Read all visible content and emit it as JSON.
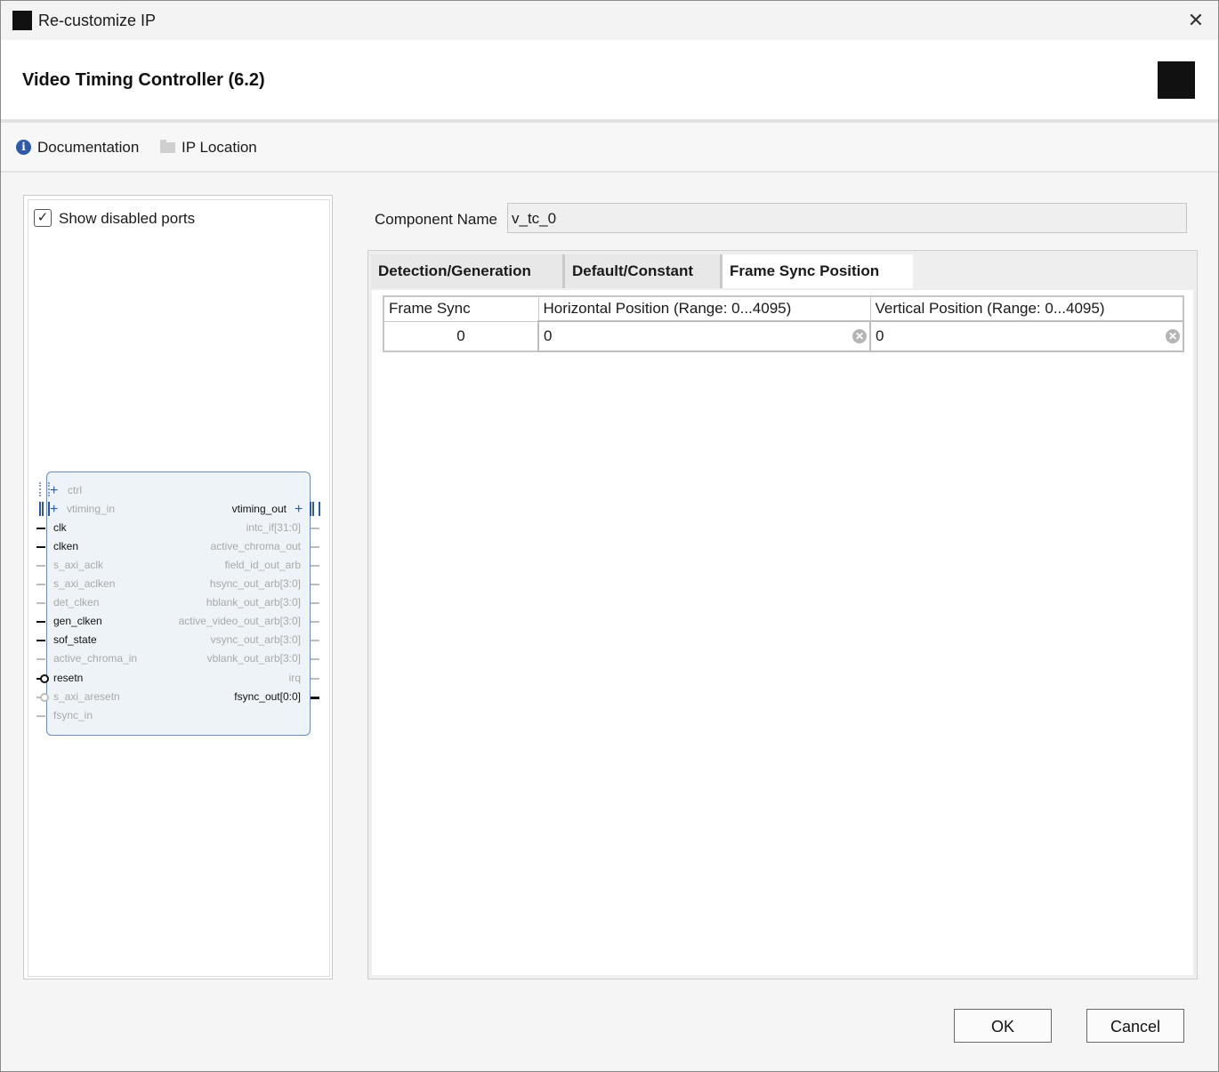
{
  "window": {
    "title": "Re-customize IP",
    "close_glyph": "✕"
  },
  "header": {
    "ip_title": "Video Timing Controller (6.2)"
  },
  "links": {
    "documentation": "Documentation",
    "ip_location": "IP Location"
  },
  "left_panel": {
    "show_disabled_ports_label": "Show disabled ports",
    "show_disabled_ports_checked": true,
    "block_ports_left": [
      {
        "name": "ctrl",
        "enabled": false
      },
      {
        "name": "vtiming_in",
        "enabled": false
      },
      {
        "name": "clk",
        "enabled": true
      },
      {
        "name": "clken",
        "enabled": true
      },
      {
        "name": "s_axi_aclk",
        "enabled": false
      },
      {
        "name": "s_axi_aclken",
        "enabled": false
      },
      {
        "name": "det_clken",
        "enabled": false
      },
      {
        "name": "gen_clken",
        "enabled": true
      },
      {
        "name": "sof_state",
        "enabled": true
      },
      {
        "name": "active_chroma_in",
        "enabled": false
      },
      {
        "name": "resetn",
        "enabled": true
      },
      {
        "name": "s_axi_aresetn",
        "enabled": false
      },
      {
        "name": "fsync_in",
        "enabled": false
      }
    ],
    "block_ports_right": [
      {
        "name": "vtiming_out",
        "enabled": true
      },
      {
        "name": "intc_if[31:0]",
        "enabled": false
      },
      {
        "name": "active_chroma_out",
        "enabled": false
      },
      {
        "name": "field_id_out_arb",
        "enabled": false
      },
      {
        "name": "hsync_out_arb[3:0]",
        "enabled": false
      },
      {
        "name": "hblank_out_arb[3:0]",
        "enabled": false
      },
      {
        "name": "active_video_out_arb[3:0]",
        "enabled": false
      },
      {
        "name": "vsync_out_arb[3:0]",
        "enabled": false
      },
      {
        "name": "vblank_out_arb[3:0]",
        "enabled": false
      },
      {
        "name": "irq",
        "enabled": false
      },
      {
        "name": "fsync_out[0:0]",
        "enabled": true
      }
    ]
  },
  "component": {
    "label": "Component Name",
    "value": "v_tc_0"
  },
  "tabs": [
    {
      "label": "Detection/Generation",
      "active": false
    },
    {
      "label": "Default/Constant",
      "active": false
    },
    {
      "label": "Frame Sync Position",
      "active": true
    }
  ],
  "frame_sync_table": {
    "headers": [
      "Frame Sync",
      "Horizontal Position (Range: 0...4095)",
      "Vertical Position (Range: 0...4095)"
    ],
    "rows": [
      {
        "frame_sync": "0",
        "horizontal": "0",
        "vertical": "0"
      }
    ]
  },
  "buttons": {
    "ok": "OK",
    "cancel": "Cancel"
  }
}
